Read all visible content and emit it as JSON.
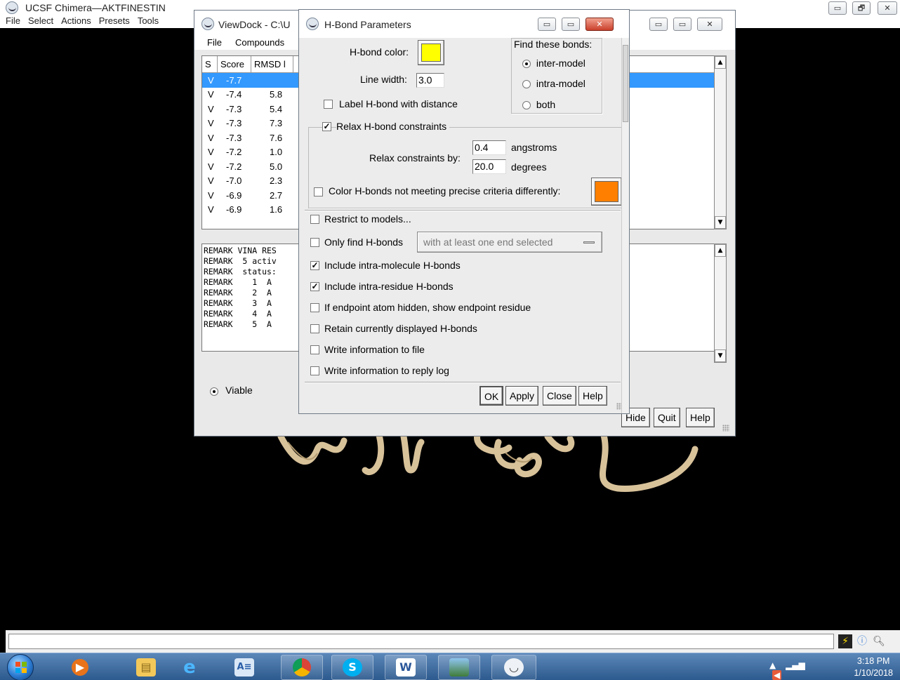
{
  "chimera": {
    "title": "UCSF Chimera—AKTFINESTIN",
    "menu": [
      "File",
      "Select",
      "Actions",
      "Presets",
      "Tools"
    ],
    "controls": {
      "minimize": "▭",
      "maximize": "🗗",
      "close": "✕"
    }
  },
  "viewdock": {
    "title": "ViewDock - C:\\U",
    "menu": [
      "File",
      "Compounds"
    ],
    "controls": {
      "minimize": "▭",
      "maximize": "▭",
      "close": "✕"
    },
    "table": {
      "columns": [
        "S",
        "Score",
        "RMSD l"
      ],
      "rows": [
        {
          "s": "V",
          "score": "-7.7",
          "rmsd": ""
        },
        {
          "s": "V",
          "score": "-7.4",
          "rmsd": "5.8"
        },
        {
          "s": "V",
          "score": "-7.3",
          "rmsd": "5.4"
        },
        {
          "s": "V",
          "score": "-7.3",
          "rmsd": "7.3"
        },
        {
          "s": "V",
          "score": "-7.3",
          "rmsd": "7.6"
        },
        {
          "s": "V",
          "score": "-7.2",
          "rmsd": "1.0"
        },
        {
          "s": "V",
          "score": "-7.2",
          "rmsd": "5.0"
        },
        {
          "s": "V",
          "score": "-7.0",
          "rmsd": "2.3"
        },
        {
          "s": "V",
          "score": "-6.9",
          "rmsd": "2.7"
        },
        {
          "s": "V",
          "score": "-6.9",
          "rmsd": "1.6"
        }
      ]
    },
    "remark_lines": [
      "REMARK VINA RES",
      "REMARK  5 activ",
      "REMARK  status:",
      "REMARK    1  A",
      "REMARK    2  A",
      "REMARK    3  A",
      "REMARK    4  A",
      "REMARK    5  A"
    ],
    "viable_label": "Viable",
    "buttons": {
      "hide": "Hide",
      "quit": "Quit",
      "help": "Help"
    }
  },
  "hbond": {
    "title": "H-Bond Parameters",
    "controls": {
      "minimize": "▭",
      "maximize": "▭",
      "close": "✕"
    },
    "hbond_color_label": "H-bond color:",
    "hbond_color": "#ffff00",
    "line_width_label": "Line width:",
    "line_width": "3.0",
    "label_distance": "Label H-bond with distance",
    "find_group_title": "Find these bonds:",
    "find_options": [
      "inter-model",
      "intra-model",
      "both"
    ],
    "find_selected": "inter-model",
    "relax_label": "Relax H-bond constraints",
    "relax_by_label": "Relax constraints by:",
    "relax_distance": "0.4",
    "relax_distance_unit": "angstroms",
    "relax_angle": "20.0",
    "relax_angle_unit": "degrees",
    "color_diff_label": "Color H-bonds not meeting precise criteria differently:",
    "diff_color": "#ff8000",
    "restrict_label": "Restrict to models...",
    "only_find_label": "Only find H-bonds",
    "only_find_value": "with at least one end selected",
    "options": [
      {
        "label": "Include intra-molecule H-bonds",
        "checked": true
      },
      {
        "label": "Include intra-residue H-bonds",
        "checked": true
      },
      {
        "label": "If endpoint atom hidden, show endpoint residue",
        "checked": false
      },
      {
        "label": "Retain currently displayed H-bonds",
        "checked": false
      },
      {
        "label": "Write information to file",
        "checked": false
      },
      {
        "label": "Write information to reply log",
        "checked": false
      }
    ],
    "buttons": {
      "ok": "OK",
      "apply": "Apply",
      "close": "Close",
      "help": "Help"
    }
  },
  "taskbar": {
    "time": "3:18 PM",
    "date": "1/10/2018",
    "apps": [
      "media-player-icon",
      "file-explorer-icon",
      "internet-explorer-icon",
      "text-editor-icon",
      "chrome-icon",
      "skype-icon",
      "word-icon",
      "image-viewer-icon",
      "chimera-icon"
    ]
  }
}
